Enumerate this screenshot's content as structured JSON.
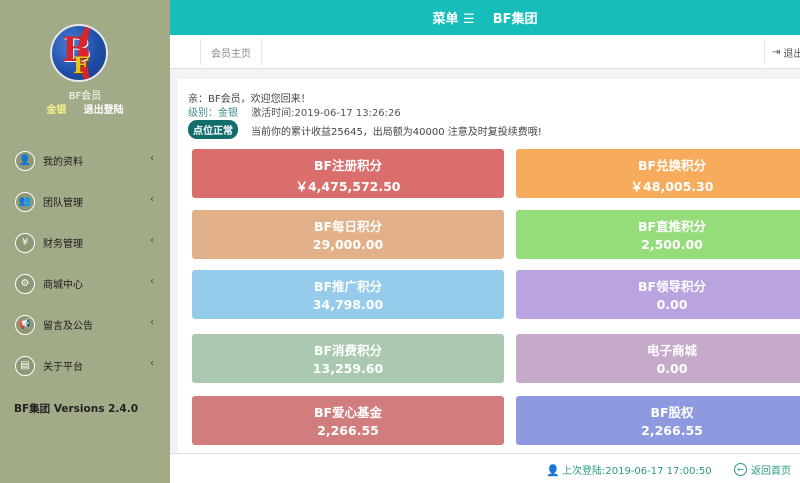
{
  "sidebar": {
    "user_name": "BF会员",
    "level_link": "金银",
    "logout_link": "退出登陆",
    "version": "BF集团 Versions 2.4.0",
    "items": [
      {
        "label": "我的资料",
        "icon": "user-icon",
        "glyph": "👤"
      },
      {
        "label": "团队管理",
        "icon": "team-icon",
        "glyph": "👥"
      },
      {
        "label": "财务管理",
        "icon": "yen-icon",
        "glyph": "¥"
      },
      {
        "label": "商城中心",
        "icon": "shop-icon",
        "glyph": "⚙"
      },
      {
        "label": "留言及公告",
        "icon": "megaphone-icon",
        "glyph": "📢"
      },
      {
        "label": "关于平台",
        "icon": "document-icon",
        "glyph": "▤"
      }
    ],
    "arrow": "‹"
  },
  "topbar": {
    "menu_label": "菜单 ☰",
    "brand": "BF集团"
  },
  "tabs": {
    "home": "会员主页",
    "exit": "退出"
  },
  "main": {
    "greeting": "亲：BF会员，欢迎您回来！",
    "level_label": "级别：金银",
    "activation_time": "激活时间:2019-06-17 13:26:26",
    "status_button": "点位正常",
    "notice": "当前你的累计收益25645，出局额为40000 注意及时复投续费哦!"
  },
  "cards": [
    {
      "title": "BF注册积分",
      "value": "￥4,475,572.50",
      "color": "#da6e6c"
    },
    {
      "title": "BF兑换积分",
      "value": "￥48,005.30",
      "color": "#f7ac5d"
    },
    {
      "title": "BF每日积分",
      "value": "29,000.00",
      "color": "#e3b189"
    },
    {
      "title": "BF直推积分",
      "value": "2,500.00",
      "color": "#95dc7b"
    },
    {
      "title": "BF推广积分",
      "value": "34,798.00",
      "color": "#95cbeb"
    },
    {
      "title": "BF领导积分",
      "value": "0.00",
      "color": "#b9a4e0"
    },
    {
      "title": "BF消费积分",
      "value": "13,259.60",
      "color": "#abc8b0"
    },
    {
      "title": "电子商城",
      "value": "0.00",
      "color": "#c6aac9"
    },
    {
      "title": "BF爱心基金",
      "value": "2,266.55",
      "color": "#d17c7d"
    },
    {
      "title": "BF股权",
      "value": "2,266.55",
      "color": "#8e99df"
    }
  ],
  "footer": {
    "last_login": "上次登陆:2019-06-17 17:00:50",
    "back_home": "返回首页"
  }
}
